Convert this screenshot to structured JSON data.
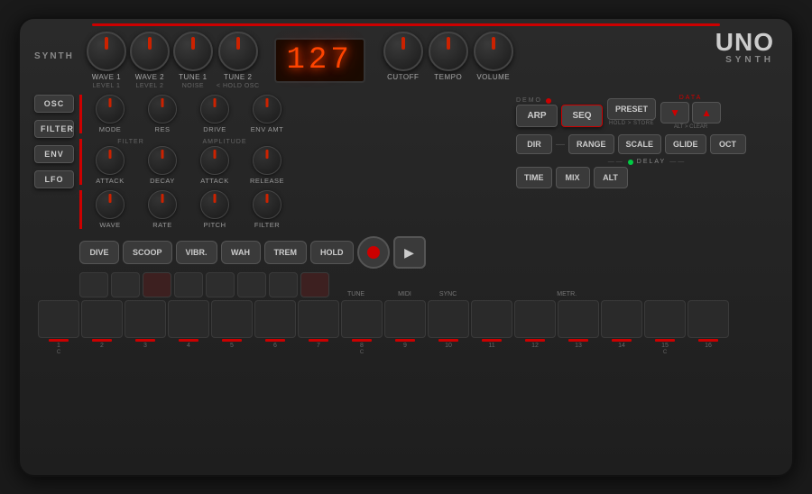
{
  "device": {
    "name": "UNO Synth",
    "logo_line1": "UNO",
    "logo_line2": "SYNTH"
  },
  "display": {
    "value": "127"
  },
  "synth_label": "SYNTH",
  "top_knobs": [
    {
      "label": "WAVE 1",
      "sublabel": "LEVEL 1"
    },
    {
      "label": "WAVE 2",
      "sublabel": "LEVEL 2"
    },
    {
      "label": "TUNE 1",
      "sublabel": "NOISE"
    },
    {
      "label": "TUNE 2",
      "sublabel": "< HOLD OSC"
    }
  ],
  "right_knobs": [
    {
      "label": "CUTOFF"
    },
    {
      "label": "TEMPO"
    },
    {
      "label": "VOLUME"
    }
  ],
  "sidebar_buttons": [
    {
      "label": "OSC"
    },
    {
      "label": "FILTER"
    },
    {
      "label": "ENV"
    },
    {
      "label": "LFO"
    }
  ],
  "param_rows": [
    {
      "items": [
        {
          "label": "MODE"
        },
        {
          "label": "RES"
        },
        {
          "label": "DRIVE"
        },
        {
          "label": "ENV AMT"
        }
      ]
    },
    {
      "group_labels": [
        "FILTER",
        "AMPLITUDE"
      ],
      "items": [
        {
          "label": "ATTACK"
        },
        {
          "label": "DECAY"
        },
        {
          "label": "ATTACK"
        },
        {
          "label": "RELEASE"
        }
      ]
    },
    {
      "items": [
        {
          "label": "WAVE"
        },
        {
          "label": "RATE"
        },
        {
          "label": "PITCH"
        },
        {
          "label": "FILTER"
        }
      ]
    }
  ],
  "mod_buttons": [
    {
      "label": "DIVE"
    },
    {
      "label": "SCOOP"
    },
    {
      "label": "VIBR."
    },
    {
      "label": "WAH"
    },
    {
      "label": "TREM"
    },
    {
      "label": "HOLD"
    }
  ],
  "transport": {
    "record": "REC",
    "play": "▶"
  },
  "arp_seq": {
    "demo_label": "DEMO",
    "arp": "ARP",
    "seq": "SEQ"
  },
  "preset": {
    "label": "PRESET",
    "sublabel": "HOLD > STORE"
  },
  "data": {
    "label": "DATA",
    "down": "▼",
    "up": "▲",
    "sublabel": "ALT > CLEAR"
  },
  "nav_buttons": [
    {
      "label": "DIR"
    },
    {
      "label": "RANGE"
    },
    {
      "label": "SCALE"
    },
    {
      "label": "GLIDE"
    },
    {
      "label": "OCT"
    }
  ],
  "delay": {
    "label": "DELAY",
    "time": "TIME",
    "mix": "MIX",
    "alt": "ALT"
  },
  "bottom_labels": [
    {
      "label": "TUNE"
    },
    {
      "label": "MIDI"
    },
    {
      "label": "SYNC"
    },
    {
      "label": "METR."
    }
  ],
  "keys": [
    {
      "number": "1",
      "note": "C",
      "has_dot": true
    },
    {
      "number": "2",
      "note": "",
      "has_dot": true
    },
    {
      "number": "3",
      "note": "",
      "has_dot": true
    },
    {
      "number": "4",
      "note": "",
      "has_dot": true
    },
    {
      "number": "5",
      "note": "",
      "has_dot": true
    },
    {
      "number": "6",
      "note": "",
      "has_dot": true
    },
    {
      "number": "7",
      "note": "",
      "has_dot": true
    },
    {
      "number": "8",
      "note": "C",
      "has_dot": true
    },
    {
      "number": "9",
      "note": "",
      "has_dot": true
    },
    {
      "number": "10",
      "note": "",
      "has_dot": true
    },
    {
      "number": "11",
      "note": "",
      "has_dot": true
    },
    {
      "number": "12",
      "note": "",
      "has_dot": true
    },
    {
      "number": "13",
      "note": "",
      "has_dot": true
    },
    {
      "number": "14",
      "note": "",
      "has_dot": true
    },
    {
      "number": "15",
      "note": "C",
      "has_dot": true
    },
    {
      "number": "16",
      "note": "",
      "has_dot": true
    }
  ],
  "colors": {
    "accent": "#cc0000",
    "led": "#ff4400",
    "green": "#00cc44",
    "dark": "#1e1e1e",
    "mid": "#2d2d2d"
  }
}
